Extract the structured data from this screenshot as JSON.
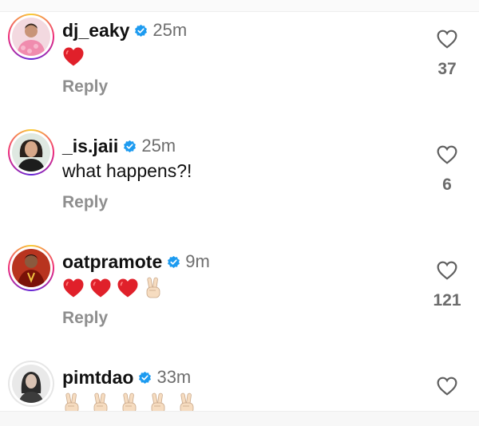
{
  "colors": {
    "verified": "#1d9bf0",
    "heart_emoji": "#e0202a",
    "meta_text": "#6e6e6e",
    "reply_text": "#8e8e8e"
  },
  "comments": [
    {
      "username": "dj_eaky",
      "time": "25m",
      "verified": true,
      "text": "",
      "emojis": [
        "red-heart"
      ],
      "reply_label": "Reply",
      "like_count": "37"
    },
    {
      "username": "_is.jaii",
      "time": "25m",
      "verified": true,
      "text": "what happens?!",
      "emojis": [],
      "reply_label": "Reply",
      "like_count": "6"
    },
    {
      "username": "oatpramote",
      "time": "9m",
      "verified": true,
      "text": "",
      "emojis": [
        "red-heart",
        "red-heart",
        "red-heart",
        "victory-hand"
      ],
      "reply_label": "Reply",
      "like_count": "121"
    },
    {
      "username": "pimtdao",
      "time": "33m",
      "verified": true,
      "text": "",
      "emojis": [
        "victory-hand",
        "victory-hand",
        "victory-hand",
        "victory-hand",
        "victory-hand"
      ],
      "reply_label": "",
      "like_count": ""
    }
  ]
}
